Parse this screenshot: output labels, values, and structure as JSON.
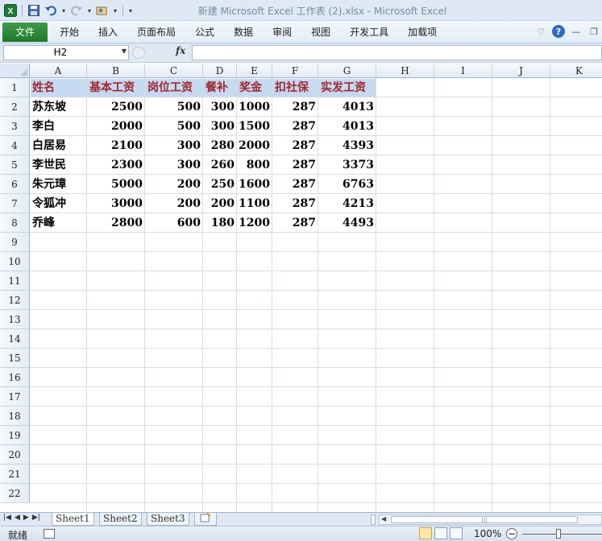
{
  "window": {
    "title": "新建 Microsoft Excel 工作表 (2).xlsx  -  Microsoft Excel"
  },
  "qat": {
    "icons": [
      "excel-app-icon",
      "save-icon",
      "undo-icon",
      "redo-icon",
      "customize-icon"
    ]
  },
  "ribbon": {
    "file_tab": "文件",
    "tabs": [
      "开始",
      "插入",
      "页面布局",
      "公式",
      "数据",
      "审阅",
      "视图",
      "开发工具",
      "加载项"
    ]
  },
  "formula_bar": {
    "name_box": "H2",
    "fx_label": "fx",
    "value": ""
  },
  "sheet": {
    "columns": [
      "A",
      "B",
      "C",
      "D",
      "E",
      "F",
      "G",
      "H",
      "I",
      "J",
      "K"
    ],
    "rows": [
      "1",
      "2",
      "3",
      "4",
      "5",
      "6",
      "7",
      "8",
      "9",
      "10",
      "11",
      "12",
      "13",
      "14",
      "15",
      "16",
      "17",
      "18",
      "19",
      "20",
      "21",
      "22"
    ],
    "header": [
      "姓名",
      "基本工资",
      "岗位工资",
      "餐补",
      "奖金",
      "扣社保",
      "实发工资"
    ],
    "data": [
      [
        "苏东坡",
        "2500",
        "500",
        "300",
        "1000",
        "287",
        "4013"
      ],
      [
        "李白",
        "2000",
        "500",
        "300",
        "1500",
        "287",
        "4013"
      ],
      [
        "白居易",
        "2100",
        "300",
        "280",
        "2000",
        "287",
        "4393"
      ],
      [
        "李世民",
        "2300",
        "300",
        "260",
        "800",
        "287",
        "3373"
      ],
      [
        "朱元璋",
        "5000",
        "200",
        "250",
        "1600",
        "287",
        "6763"
      ],
      [
        "令狐冲",
        "3000",
        "200",
        "200",
        "1100",
        "287",
        "4213"
      ],
      [
        "乔峰",
        "2800",
        "600",
        "180",
        "1200",
        "287",
        "4493"
      ]
    ],
    "header_color": "#a1282f",
    "header_fill": "#c5d9f1"
  },
  "sheet_tabs": [
    "Sheet1",
    "Sheet2",
    "Sheet3"
  ],
  "status": {
    "ready": "就绪",
    "zoom": "100%",
    "zoom_minus": "−"
  }
}
